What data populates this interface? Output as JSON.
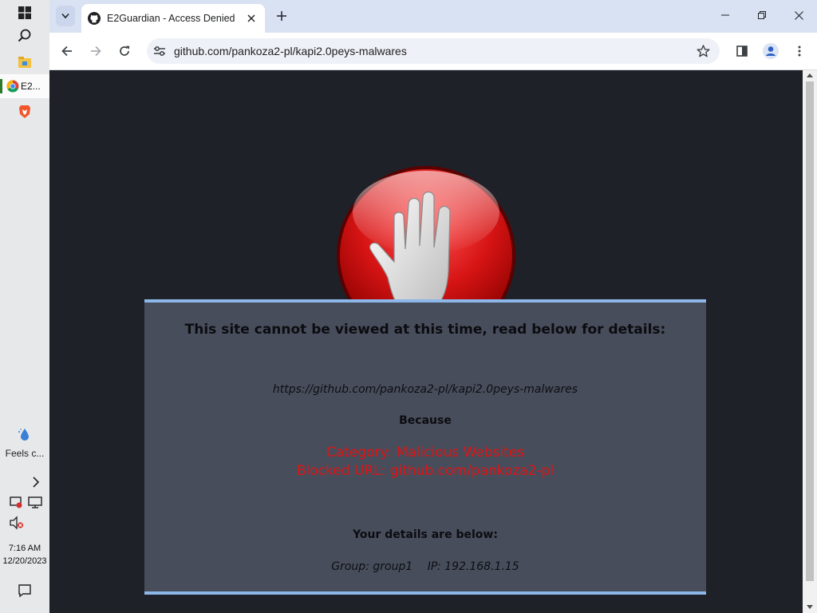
{
  "taskbar": {
    "active_app_label": "E2...",
    "weather_text": "Feels c...",
    "time": "7:16 AM",
    "date": "12/20/2023"
  },
  "browser": {
    "tab_title": "E2Guardian - Access Denied",
    "address": "github.com/pankoza2-pl/kapi2.0peys-malwares"
  },
  "block_page": {
    "heading": "This site cannot be viewed at this time, read below for details:",
    "requested_url": "https://github.com/pankoza2-pl/kapi2.0peys-malwares",
    "because_label": "Because",
    "category_line": "Category: Malicious Websites",
    "blocked_line": "Blocked URL: github.com/pankoza2-pl",
    "details_label": "Your details are below:",
    "group_text": "Group: group1",
    "ip_text": "IP: 192.168.1.15"
  },
  "colors": {
    "page_bg": "#1f2128",
    "panel_bg": "#474d5b",
    "panel_border": "#8db7e8",
    "alert_red": "#e01414",
    "tabstrip_bg": "#d9e2f3"
  },
  "icons": [
    "windows-start-icon",
    "search-icon",
    "file-explorer-icon",
    "chrome-icon",
    "brave-icon",
    "weather-icon",
    "chevron-right-icon",
    "network-icon",
    "display-icon",
    "volume-muted-icon",
    "notification-icon",
    "tab-list-icon",
    "github-icon",
    "close-icon",
    "new-tab-icon",
    "minimize-icon",
    "restore-icon",
    "back-icon",
    "forward-icon",
    "reload-icon",
    "site-info-icon",
    "bookmark-star-icon",
    "side-panel-icon",
    "profile-icon",
    "menu-icon",
    "stop-hand-icon"
  ]
}
